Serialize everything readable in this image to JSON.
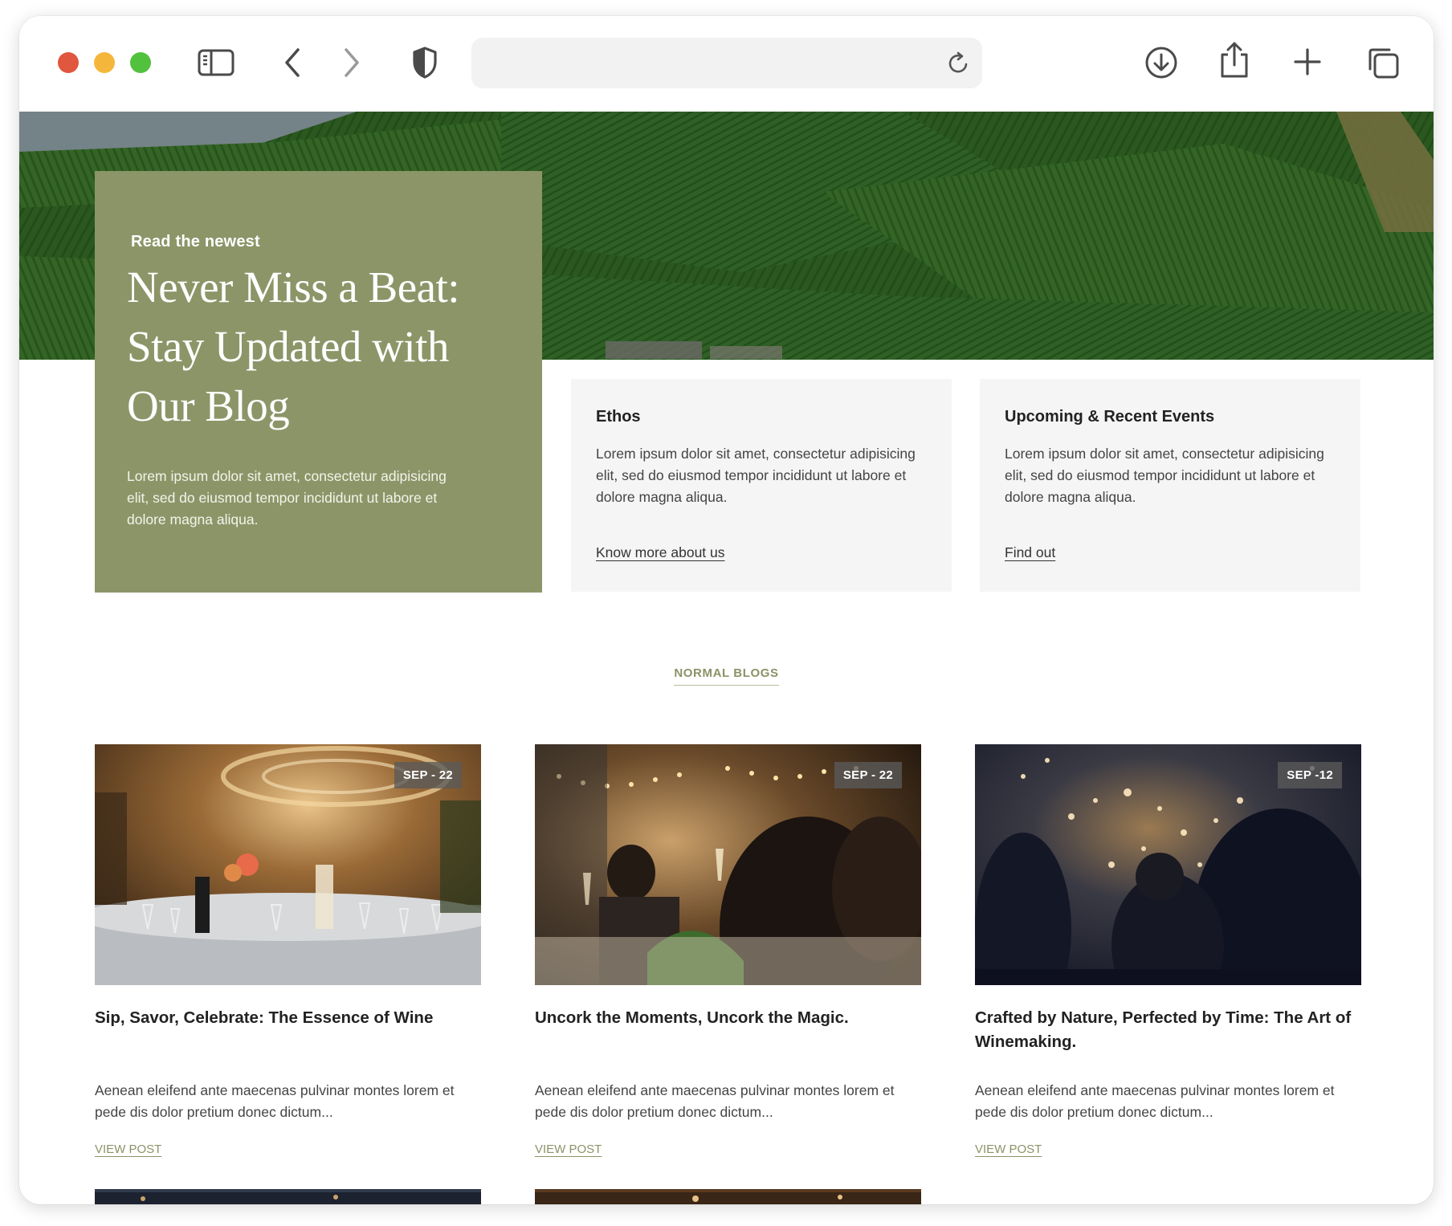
{
  "browser": {
    "toolbar_icons": [
      "sidebar-icon",
      "back-icon",
      "forward-icon",
      "shield-icon",
      "reload-icon",
      "download-icon",
      "share-icon",
      "new-tab-icon",
      "tabs-overview-icon"
    ],
    "url_value": ""
  },
  "hero": {
    "kicker": "Read the newest",
    "headline": "Never Miss a Beat: Stay Updated with Our Blog",
    "body": "Lorem ipsum dolor sit amet, consectetur adipisicing elit, sed do eiusmod tempor incididunt ut labore et dolore magna aliqua.",
    "accent_color": "#8c9568"
  },
  "info_cards": [
    {
      "title": "Ethos",
      "body": "Lorem ipsum dolor sit amet, consectetur adipisicing elit, sed do eiusmod tempor incididunt ut labore et dolore magna aliqua.",
      "link": "Know more about us"
    },
    {
      "title": "Upcoming & Recent Events",
      "body": "Lorem ipsum dolor sit amet, consectetur adipisicing elit, sed do eiusmod tempor incididunt ut labore et dolore magna aliqua.",
      "link": "Find out"
    }
  ],
  "section_label": "NORMAL BLOGS",
  "blogs": [
    {
      "date": "SEP - 22",
      "title": "Sip, Savor, Celebrate: The Essence of Wine",
      "excerpt": "Aenean eleifend ante maecenas pulvinar montes lorem et pede dis dolor pretium donec dictum...",
      "cta": "VIEW POST"
    },
    {
      "date": "SEP - 22",
      "title": "Uncork the Moments, Uncork the Magic.",
      "excerpt": "Aenean eleifend ante maecenas pulvinar montes lorem et pede dis dolor pretium donec dictum...",
      "cta": "VIEW POST"
    },
    {
      "date": "SEP -12",
      "title": "Crafted by Nature, Perfected by Time: The Art of Winemaking.",
      "excerpt": "Aenean eleifend ante maecenas pulvinar montes lorem et pede dis dolor pretium donec dictum...",
      "cta": "VIEW POST"
    }
  ]
}
